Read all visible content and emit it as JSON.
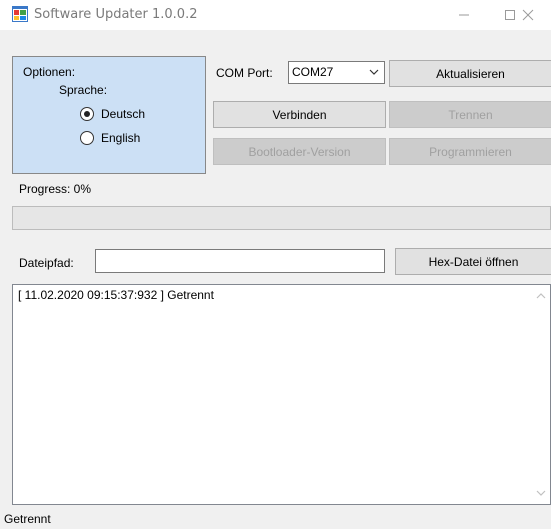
{
  "window": {
    "title": "Software Updater 1.0.0.2"
  },
  "options": {
    "group_label": "Optionen:",
    "language_label": "Sprache:",
    "languages": [
      {
        "label": "Deutsch",
        "selected": true
      },
      {
        "label": "English",
        "selected": false
      }
    ]
  },
  "com": {
    "label": "COM Port:",
    "selected": "COM27"
  },
  "buttons": {
    "refresh": "Aktualisieren",
    "connect": "Verbinden",
    "disconnect": "Trennen",
    "bootloader": "Bootloader-Version",
    "program": "Programmieren",
    "open_hex": "Hex-Datei öffnen"
  },
  "progress": {
    "label": "Progress:  0%",
    "value_percent": 0
  },
  "file": {
    "label": "Dateipfad:",
    "value": ""
  },
  "log": {
    "lines": "[ 11.02.2020 09:15:37:932 ] Getrennt"
  },
  "status": {
    "text": "Getrennt"
  },
  "icons": {
    "app": "app-window-icon",
    "minimize": "minimize-icon",
    "maximize": "maximize-icon",
    "close": "close-icon",
    "dropdown": "chevron-down-icon"
  },
  "colors": {
    "options_background": "#cce0f5",
    "window_background": "#f0f0f0"
  }
}
